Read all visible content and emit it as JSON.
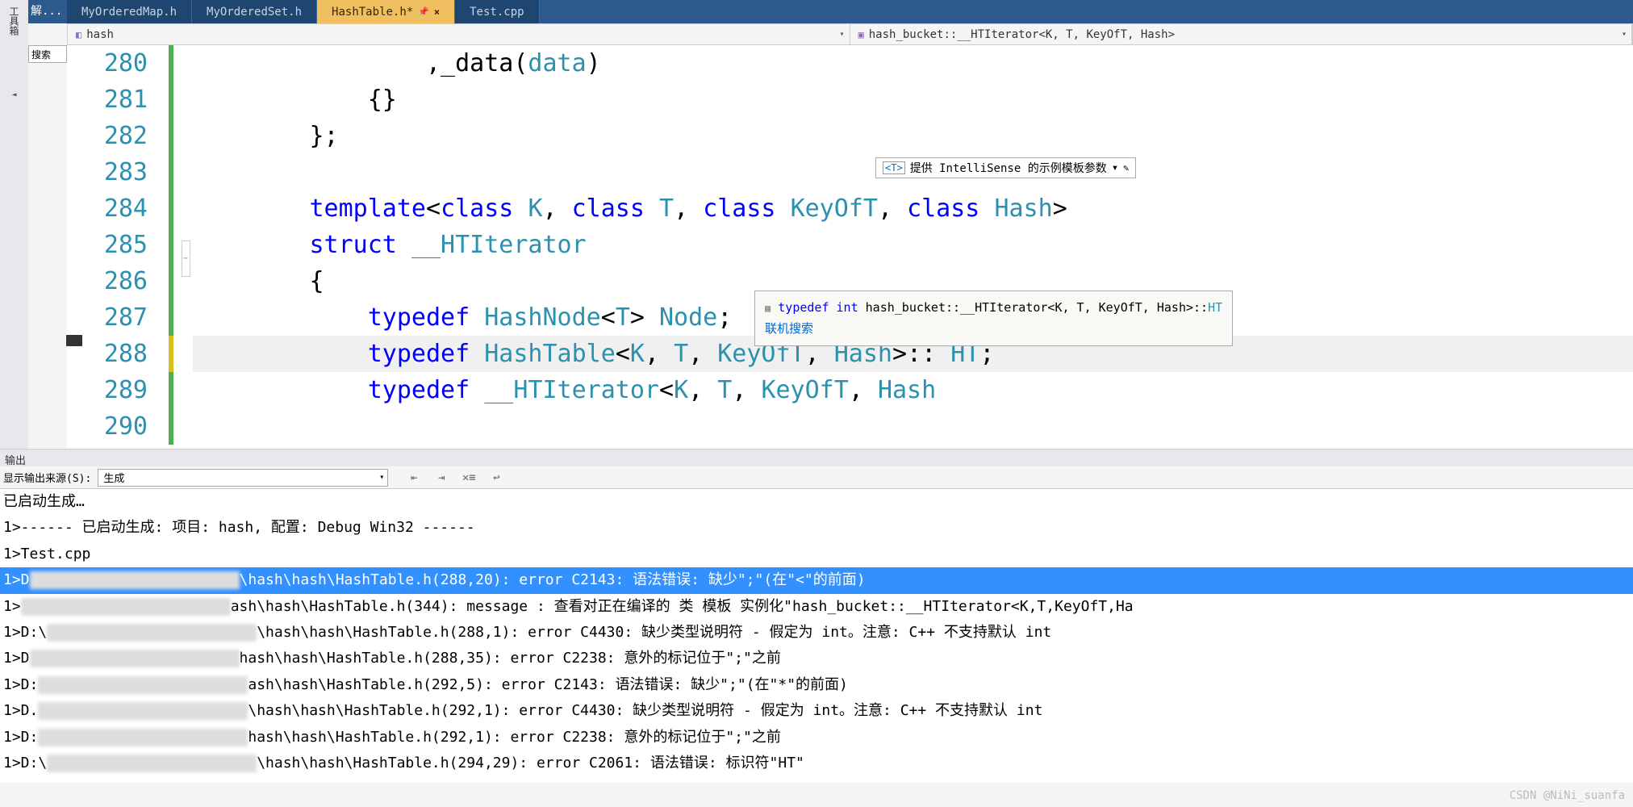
{
  "left_strip": {
    "toolbox": "工具箱"
  },
  "search": {
    "placeholder": "搜索"
  },
  "resolve_tab": "解...",
  "tabs": [
    {
      "label": "MyOrderedMap.h",
      "active": false
    },
    {
      "label": "MyOrderedSet.h",
      "active": false
    },
    {
      "label": "HashTable.h*",
      "active": true
    },
    {
      "label": "Test.cpp",
      "active": false
    }
  ],
  "dropdowns": {
    "left": "hash",
    "right": "hash_bucket::__HTIterator<K, T, KeyOfT, Hash>"
  },
  "tpl_hint": {
    "tag": "<T>",
    "text": "提供 IntelliSense 的示例模板参数"
  },
  "code": {
    "lines": [
      {
        "n": 280,
        "indent": "                ",
        "tokens": [
          {
            "t": ",",
            "c": "punct"
          },
          {
            "t": "_data",
            "c": "punct"
          },
          {
            "t": "(",
            "c": "punct"
          },
          {
            "t": "data",
            "c": "type"
          },
          {
            "t": ")",
            "c": "punct"
          }
        ]
      },
      {
        "n": 281,
        "indent": "            ",
        "tokens": [
          {
            "t": "{}",
            "c": "punct"
          }
        ]
      },
      {
        "n": 282,
        "indent": "        ",
        "tokens": [
          {
            "t": "};",
            "c": "punct"
          }
        ]
      },
      {
        "n": 283,
        "indent": "",
        "tokens": []
      },
      {
        "n": 284,
        "indent": "        ",
        "tokens": [
          {
            "t": "template",
            "c": "kw"
          },
          {
            "t": "<",
            "c": "punct"
          },
          {
            "t": "class",
            "c": "kw"
          },
          {
            "t": " ",
            "c": "punct"
          },
          {
            "t": "K",
            "c": "type"
          },
          {
            "t": ", ",
            "c": "punct"
          },
          {
            "t": "class",
            "c": "kw"
          },
          {
            "t": " ",
            "c": "punct"
          },
          {
            "t": "T",
            "c": "type"
          },
          {
            "t": ", ",
            "c": "punct"
          },
          {
            "t": "class",
            "c": "kw"
          },
          {
            "t": " ",
            "c": "punct"
          },
          {
            "t": "KeyOfT",
            "c": "type"
          },
          {
            "t": ", ",
            "c": "punct"
          },
          {
            "t": "class",
            "c": "kw"
          },
          {
            "t": " ",
            "c": "punct"
          },
          {
            "t": "Hash",
            "c": "type"
          },
          {
            "t": ">",
            "c": "punct"
          }
        ]
      },
      {
        "n": 285,
        "indent": "        ",
        "tokens": [
          {
            "t": "struct",
            "c": "kw"
          },
          {
            "t": " ",
            "c": "punct"
          },
          {
            "t": "__HTIterator",
            "c": "type"
          }
        ]
      },
      {
        "n": 286,
        "indent": "        ",
        "tokens": [
          {
            "t": "{",
            "c": "punct"
          }
        ]
      },
      {
        "n": 287,
        "indent": "            ",
        "tokens": [
          {
            "t": "typedef",
            "c": "kw"
          },
          {
            "t": " ",
            "c": "punct"
          },
          {
            "t": "HashNode",
            "c": "type"
          },
          {
            "t": "<",
            "c": "punct"
          },
          {
            "t": "T",
            "c": "type"
          },
          {
            "t": "> ",
            "c": "punct"
          },
          {
            "t": "Node",
            "c": "type"
          },
          {
            "t": ";",
            "c": "punct"
          }
        ]
      },
      {
        "n": 288,
        "indent": "            ",
        "tokens": [
          {
            "t": "typedef",
            "c": "kw"
          },
          {
            "t": " ",
            "c": "punct"
          },
          {
            "t": "HashTable",
            "c": "type"
          },
          {
            "t": "<",
            "c": "punct"
          },
          {
            "t": "K",
            "c": "type"
          },
          {
            "t": ", ",
            "c": "punct"
          },
          {
            "t": "T",
            "c": "type"
          },
          {
            "t": ", ",
            "c": "punct"
          },
          {
            "t": "KeyOfT",
            "c": "type"
          },
          {
            "t": ", ",
            "c": "punct"
          },
          {
            "t": "Hash",
            "c": "type"
          },
          {
            "t": ">:: ",
            "c": "punct"
          },
          {
            "t": "HT",
            "c": "type"
          },
          {
            "t": ";",
            "c": "punct"
          }
        ],
        "caret": true
      },
      {
        "n": 289,
        "indent": "            ",
        "tokens": [
          {
            "t": "typedef",
            "c": "kw"
          },
          {
            "t": " ",
            "c": "punct"
          },
          {
            "t": "__HTIterator",
            "c": "type"
          },
          {
            "t": "<",
            "c": "punct"
          },
          {
            "t": "K",
            "c": "type"
          },
          {
            "t": ", ",
            "c": "punct"
          },
          {
            "t": "T",
            "c": "type"
          },
          {
            "t": ", ",
            "c": "punct"
          },
          {
            "t": "KeyOfT",
            "c": "type"
          },
          {
            "t": ", ",
            "c": "punct"
          },
          {
            "t": "Hash",
            "c": "type"
          }
        ]
      },
      {
        "n": 290,
        "indent": "",
        "tokens": []
      }
    ]
  },
  "tooltip": {
    "prefix_kw": "typedef int",
    "text": " hash_bucket::__HTIterator<K, T, KeyOfT, Hash>::",
    "suffix": "HT",
    "link": "联机搜索"
  },
  "output": {
    "title": "输出",
    "source_label": "显示输出来源(S):",
    "source_value": "生成",
    "lines": [
      "已启动生成…",
      "1>------ 已启动生成: 项目: hash, 配置: Debug Win32 ------",
      "1>Test.cpp",
      "1>D            \\hash\\hash\\HashTable.h(288,20): error C2143: 语法错误: 缺少\";\"(在\"<\"的前面)",
      "1>          ash\\hash\\HashTable.h(344): message : 查看对正在编译的 类 模板 实例化\"hash_bucket::__HTIterator<K,T,KeyOfT,Ha",
      "1>D:\\         \\hash\\hash\\HashTable.h(288,1): error C4430: 缺少类型说明符 - 假定为 int。注意: C++ 不支持默认 int",
      "1>D           hash\\hash\\HashTable.h(288,35): error C2238: 意外的标记位于\";\"之前",
      "1>D:          ash\\hash\\HashTable.h(292,5): error C2143: 语法错误: 缺少\";\"(在\"*\"的前面)",
      "1>D.          \\hash\\hash\\HashTable.h(292,1): error C4430: 缺少类型说明符 - 假定为 int。注意: C++ 不支持默认 int",
      "1>D:          hash\\hash\\HashTable.h(292,1): error C2238: 意外的标记位于\";\"之前",
      "1>D:\\         \\hash\\hash\\HashTable.h(294,29): error C2061: 语法错误: 标识符\"HT\""
    ],
    "selected_index": 3
  },
  "watermark": "CSDN @NiNi_suanfa"
}
